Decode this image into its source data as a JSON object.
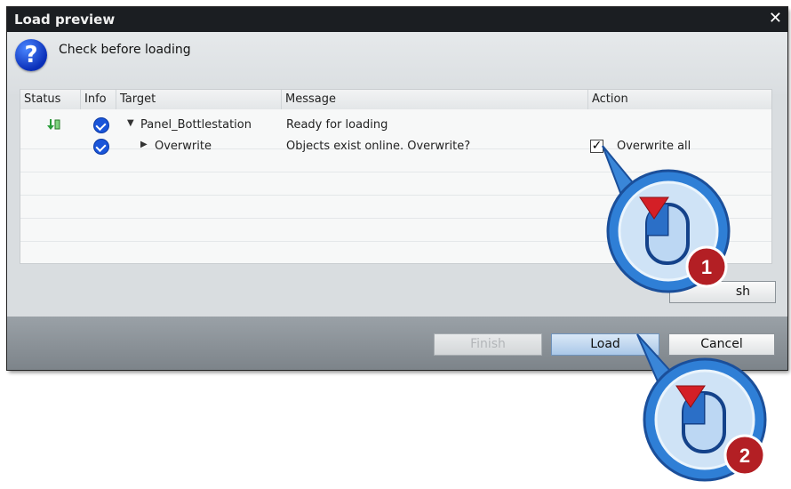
{
  "dialog": {
    "title": "Load preview",
    "close_label": "✕",
    "header_text": "Check before loading"
  },
  "table": {
    "columns": [
      "Status",
      "Info",
      "Target",
      "Message",
      "Action"
    ],
    "rows": [
      {
        "target": "Panel_Bottlestation",
        "message": "Ready for loading",
        "action": ""
      },
      {
        "target": "Overwrite",
        "message": "Objects exist online. Overwrite?",
        "action": "Overwrite all",
        "action_checked": true
      }
    ]
  },
  "buttons": {
    "refresh_partial": "sh",
    "finish": "Finish",
    "load": "Load",
    "cancel": "Cancel"
  },
  "callouts": [
    {
      "number": "1"
    },
    {
      "number": "2"
    }
  ],
  "icons": [
    "question-icon",
    "status-download-icon",
    "info-check-icon",
    "expand-triangle-icon",
    "collapse-triangle-icon",
    "mouse-click-icon"
  ],
  "colors": {
    "titlebar": "#1b1e22",
    "callout_blue": "#2f7fd6",
    "callout_badge": "#b31f24"
  }
}
